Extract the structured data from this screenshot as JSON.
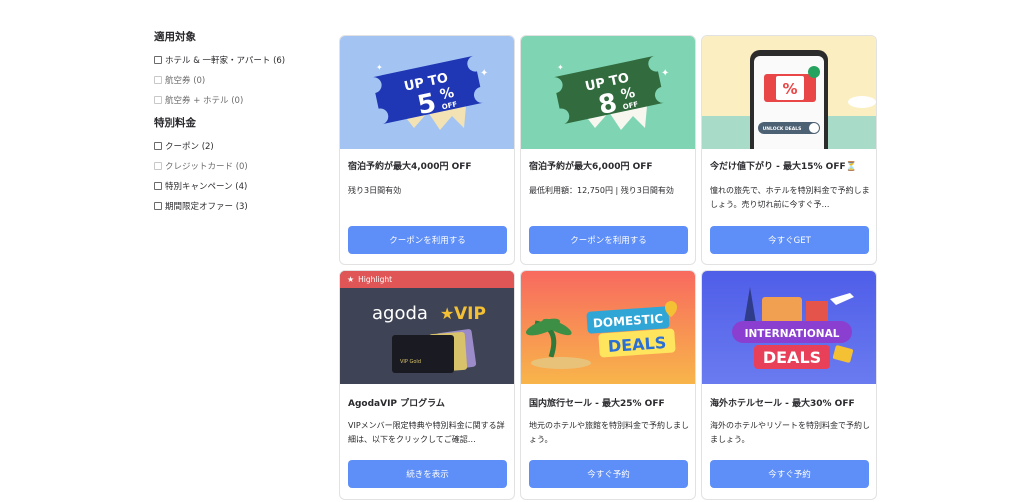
{
  "filters": {
    "group1_title": "適用対象",
    "group1_items": [
      {
        "label": "ホテル & 一軒家・アパート (6)",
        "disabled": false
      },
      {
        "label": "航空券 (0)",
        "disabled": true
      },
      {
        "label": "航空券 + ホテル (0)",
        "disabled": true
      }
    ],
    "group2_title": "特別料金",
    "group2_items": [
      {
        "label": "クーポン (2)",
        "disabled": false
      },
      {
        "label": "クレジットカード (0)",
        "disabled": true
      },
      {
        "label": "特別キャンペーン (4)",
        "disabled": false
      },
      {
        "label": "期間限定オファー (3)",
        "disabled": false
      }
    ]
  },
  "cards": [
    {
      "title": "宿泊予約が最大4,000円 OFF",
      "desc": "残り3日間有効",
      "button": "クーポンを利用する",
      "image": {
        "label_top": "UP TO",
        "label_big": "5",
        "label_unit": "%",
        "label_off": "OFF",
        "bg": "#9cc0f5",
        "ticket": "#1d35b8"
      }
    },
    {
      "title": "宿泊予約が最大6,000円 OFF",
      "desc": "最低利用額：12,750円 | 残り3日間有効",
      "button": "クーポンを利用する",
      "image": {
        "label_top": "UP TO",
        "label_big": "8",
        "label_unit": "%",
        "label_off": "OFF",
        "bg": "#79d3b0",
        "ticket": "#2f6a3c"
      }
    },
    {
      "title": "今だけ値下がり - 最大15% OFF⏳",
      "desc": "憧れの旅先で、ホテルを特別料金で予約しましょう。売り切れ前に今すぐ予…",
      "button": "今すぐGET",
      "image": {
        "phone_text": "UNLOCK DEALS",
        "percent": "%"
      }
    },
    {
      "title": "AgodaVIP プログラム",
      "desc": "VIPメンバー限定特典や特別料金に関する詳細は、以下をクリックしてご確認…",
      "button": "続きを表示",
      "badge": "Highlight",
      "image": {
        "brand": "agoda",
        "vip": "VIP",
        "card_text": "VIP Gold"
      }
    },
    {
      "title": "国内旅行セール - 最大25% OFF",
      "desc": "地元のホテルや旅館を特別料金で予約しましょう。",
      "button": "今すぐ予約",
      "image": {
        "line1": "DOMESTIC",
        "line2": "DEALS"
      }
    },
    {
      "title": "海外ホテルセール - 最大30% OFF",
      "desc": "海外のホテルやリゾートを特別料金で予約しましょう。",
      "button": "今すぐ予約",
      "image": {
        "line1": "INTERNATIONAL",
        "line2": "DEALS"
      }
    }
  ],
  "colors": {
    "button": "#5e8ef7",
    "highlight": "#e05656"
  }
}
